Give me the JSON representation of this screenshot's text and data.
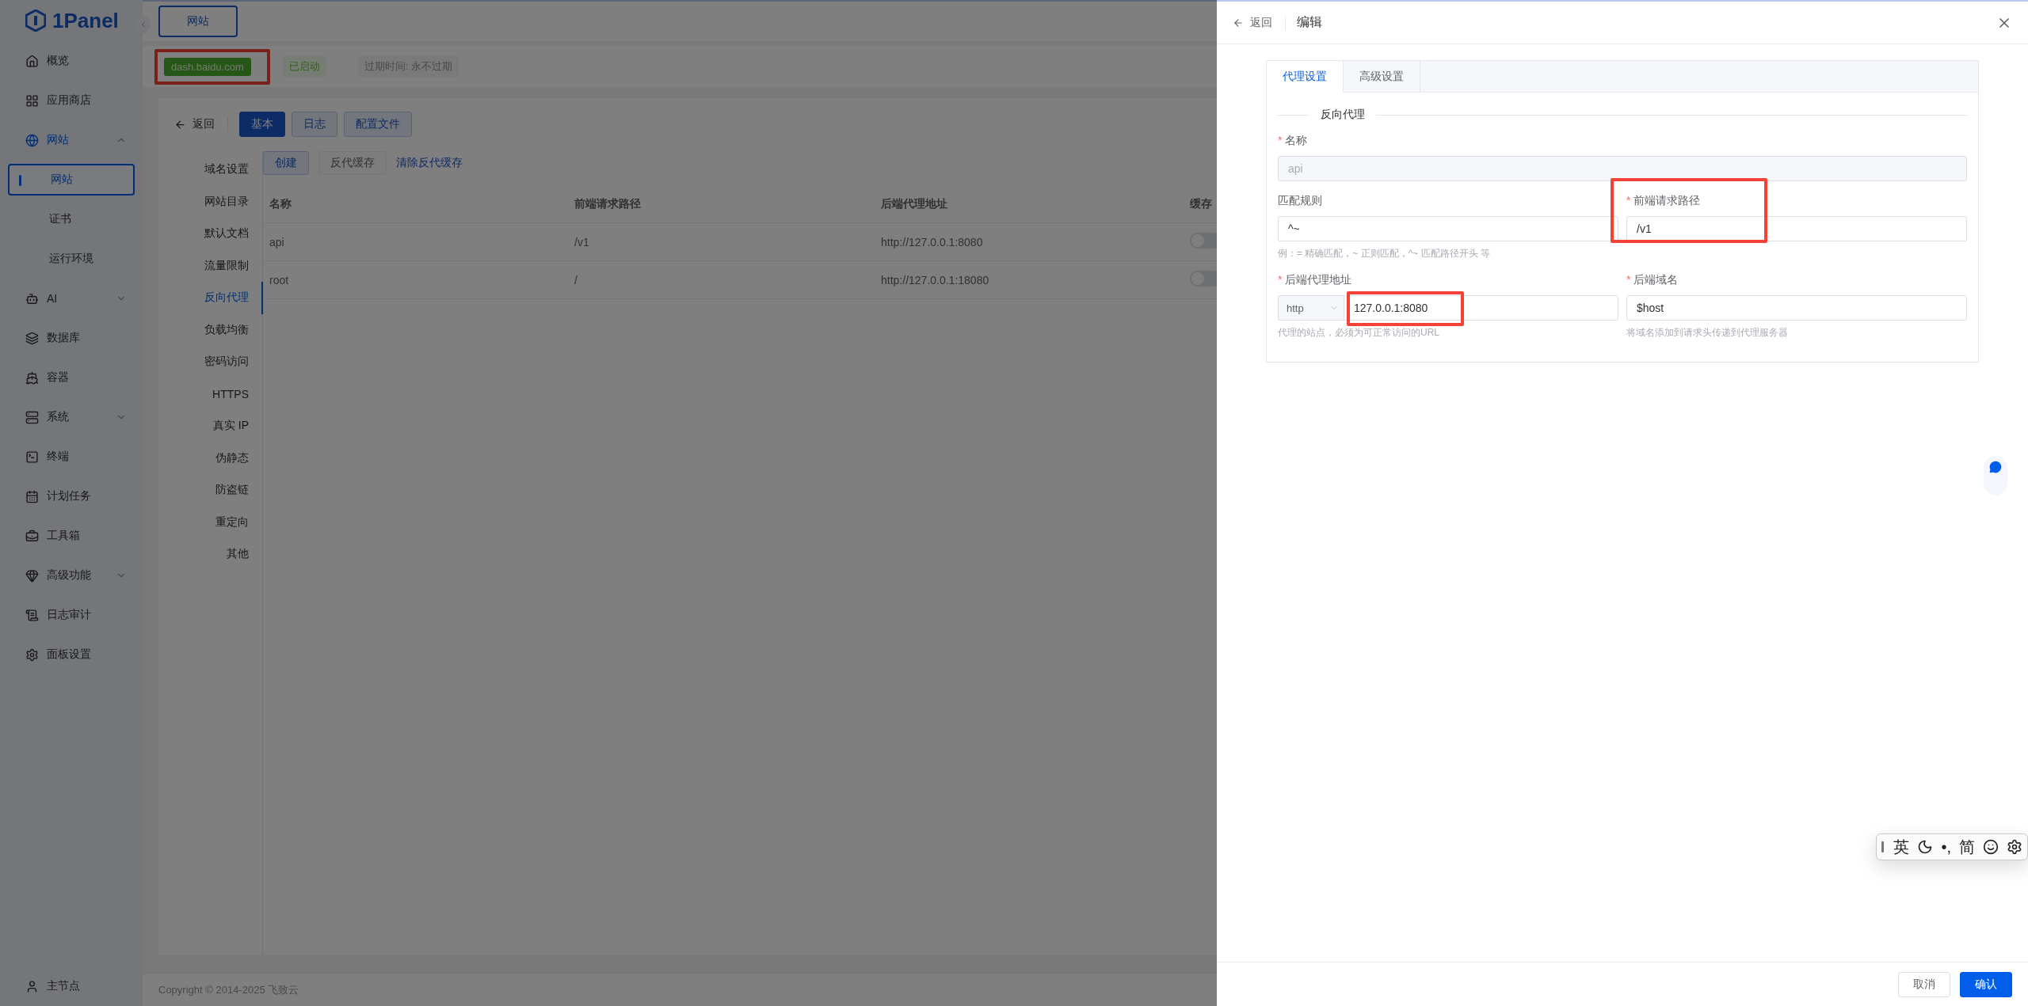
{
  "brand": "1Panel",
  "sidebar": {
    "items": [
      {
        "label": "概览",
        "kind": "link",
        "selected": false
      },
      {
        "label": "应用商店",
        "kind": "link",
        "selected": false
      },
      {
        "label": "网站",
        "kind": "group",
        "selected": true,
        "expanded": true,
        "children": [
          {
            "label": "网站",
            "selected": true
          },
          {
            "label": "证书",
            "selected": false
          },
          {
            "label": "运行环境",
            "selected": false
          }
        ]
      },
      {
        "label": "AI",
        "kind": "group",
        "selected": false,
        "expanded": false
      },
      {
        "label": "数据库",
        "kind": "link",
        "selected": false
      },
      {
        "label": "容器",
        "kind": "link",
        "selected": false
      },
      {
        "label": "系统",
        "kind": "group",
        "selected": false,
        "expanded": false
      },
      {
        "label": "终端",
        "kind": "link",
        "selected": false
      },
      {
        "label": "计划任务",
        "kind": "link",
        "selected": false
      },
      {
        "label": "工具箱",
        "kind": "link",
        "selected": false
      },
      {
        "label": "高级功能",
        "kind": "group",
        "selected": false,
        "expanded": false
      },
      {
        "label": "日志审计",
        "kind": "link",
        "selected": false
      },
      {
        "label": "面板设置",
        "kind": "link",
        "selected": false
      }
    ],
    "node": "主节点"
  },
  "header_tabs": [
    {
      "label": "网站",
      "selected": true
    }
  ],
  "site_info": {
    "domain": "dash.baidu.com",
    "highlighted": true,
    "status": "已启动",
    "expiry": "过期时间: 永不过期"
  },
  "page": {
    "back": "返回",
    "tabs": [
      {
        "label": "基本",
        "selected": true
      },
      {
        "label": "日志",
        "selected": false
      },
      {
        "label": "配置文件",
        "selected": false
      }
    ],
    "menu": [
      {
        "label": "域名设置",
        "selected": false
      },
      {
        "label": "网站目录",
        "selected": false
      },
      {
        "label": "默认文档",
        "selected": false
      },
      {
        "label": "流量限制",
        "selected": false
      },
      {
        "label": "反向代理",
        "selected": true
      },
      {
        "label": "负载均衡",
        "selected": false
      },
      {
        "label": "密码访问",
        "selected": false
      },
      {
        "label": "HTTPS",
        "selected": false
      },
      {
        "label": "真实 IP",
        "selected": false
      },
      {
        "label": "伪静态",
        "selected": false
      },
      {
        "label": "防盗链",
        "selected": false
      },
      {
        "label": "重定向",
        "selected": false
      },
      {
        "label": "其他",
        "selected": false
      }
    ],
    "actions": [
      {
        "label": "创建",
        "kind": "primary"
      },
      {
        "label": "反代缓存",
        "kind": "default"
      },
      {
        "label": "清除反代缓存",
        "kind": "link"
      }
    ],
    "table": {
      "columns": [
        "名称",
        "前端请求路径",
        "后端代理地址",
        "缓存"
      ],
      "rows": [
        {
          "name": "api",
          "path": "/v1",
          "backend": "http://127.0.0.1:8080",
          "cache": false
        },
        {
          "name": "root",
          "path": "/",
          "backend": "http://127.0.0.1:18080",
          "cache": false
        }
      ]
    }
  },
  "copyright": "Copyright © 2014-2025 飞致云",
  "drawer": {
    "back": "返回",
    "title": "编辑",
    "tabs": [
      {
        "label": "代理设置",
        "selected": true
      },
      {
        "label": "高级设置",
        "selected": false
      }
    ],
    "section": "反向代理",
    "required_mark": "*",
    "name_field": {
      "label": "名称",
      "required": true,
      "value": "api",
      "disabled": true
    },
    "match_field": {
      "label": "匹配规则",
      "required": false,
      "value": "^~",
      "help": "例：= 精确匹配，~ 正则匹配，^~ 匹配路径开头 等"
    },
    "path_field": {
      "label": "前端请求路径",
      "required": true,
      "value": "/v1",
      "highlighted": true
    },
    "backend_field": {
      "label": "后端代理地址",
      "required": true,
      "scheme": "http",
      "value": "127.0.0.1:8080",
      "help": "代理的站点，必须为可正常访问的URL",
      "highlighted": true
    },
    "host_field": {
      "label": "后端域名",
      "required": true,
      "value": "$host",
      "help": "将域名添加到请求头传递到代理服务器"
    },
    "buttons": [
      {
        "label": "取消",
        "kind": "default"
      },
      {
        "label": "确认",
        "kind": "primary"
      }
    ]
  },
  "ime_toolbar": {
    "language": "英",
    "punctuation": "•,",
    "script": "简"
  }
}
